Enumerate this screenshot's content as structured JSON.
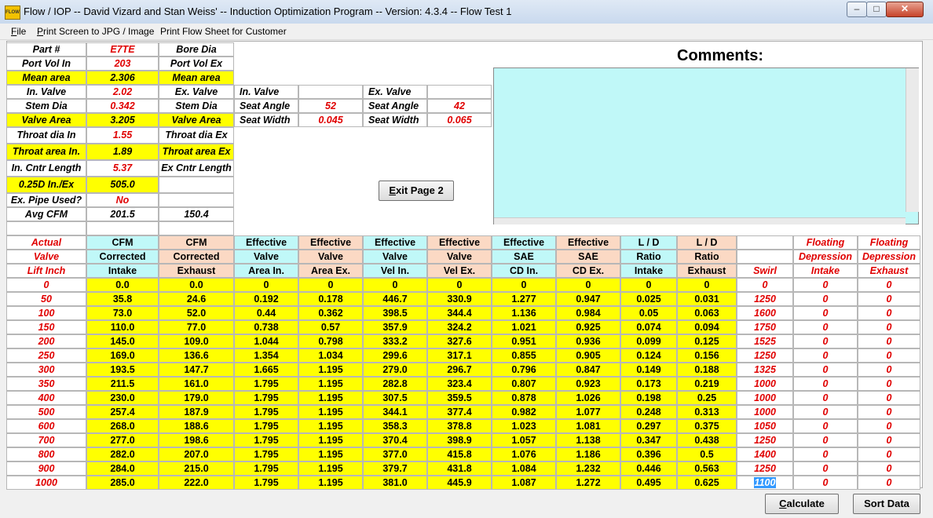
{
  "window": {
    "title": "Flow / IOP -- David Vizard and Stan Weiss' -- Induction Optimization Program -- Version: 4.3.4 -- Flow Test 1",
    "icon_text": "FLOW",
    "controls": {
      "minimize": "–",
      "maximize": "□",
      "close": "✕"
    }
  },
  "menu": [
    "File",
    "Print Screen to JPG / Image",
    "Print Flow Sheet for Customer"
  ],
  "left_table": [
    [
      "Part #",
      "E7TE",
      "Bore Dia"
    ],
    [
      "Port Vol In",
      "203",
      "Port Vol Ex"
    ],
    [
      "Mean area",
      "2.306",
      "Mean area"
    ],
    [
      "In. Valve",
      "2.02",
      "Ex. Valve"
    ],
    [
      "Stem Dia",
      "0.342",
      "Stem Dia"
    ],
    [
      "Valve Area",
      "3.205",
      "Valve Area"
    ],
    [
      "Throat dia In",
      "1.55",
      "Throat dia Ex"
    ],
    [
      "Throat area In.",
      "1.89",
      "Throat area Ex"
    ],
    [
      "In. Cntr Length",
      "5.37",
      "Ex Cntr Length"
    ],
    [
      "0.25D In./Ex",
      "505.0",
      ""
    ],
    [
      "Ex. Pipe Used?",
      "No",
      ""
    ],
    [
      "Avg CFM",
      "201.5",
      "150.4"
    ],
    [
      "",
      "",
      ""
    ]
  ],
  "seat": {
    "in_header": "In. Valve",
    "ex_header": "Ex. Valve",
    "in_angle_label": "Seat Angle",
    "in_angle": "52",
    "ex_angle_label": "Seat Angle",
    "ex_angle": "42",
    "in_width_label": "Seat Width",
    "in_width": "0.045",
    "ex_width_label": "Seat Width",
    "ex_width": "0.065"
  },
  "comments": {
    "title": "Comments:",
    "text": ""
  },
  "buttons": {
    "exit": "Exit Page 2",
    "calculate": "Calculate",
    "sort": "Sort Data"
  },
  "main_headers": [
    [
      "Actual",
      "Valve",
      "Lift Inch"
    ],
    [
      "CFM",
      "Corrected",
      "Intake"
    ],
    [
      "CFM",
      "Corrected",
      "Exhaust"
    ],
    [
      "Effective",
      "Valve",
      "Area In."
    ],
    [
      "Effective",
      "Valve",
      "Area Ex."
    ],
    [
      "Effective",
      "Valve",
      "Vel In."
    ],
    [
      "Effective",
      "Valve",
      "Vel Ex."
    ],
    [
      "Effective",
      "SAE",
      "CD In."
    ],
    [
      "Effective",
      "SAE",
      "CD Ex."
    ],
    [
      "L / D",
      "Ratio",
      "Intake"
    ],
    [
      "L / D",
      "Ratio",
      "Exhaust"
    ],
    [
      "",
      "",
      "Swirl"
    ],
    [
      "Floating",
      "Depression",
      "Intake"
    ],
    [
      "Floating",
      "Depression",
      "Exhaust"
    ]
  ],
  "main_rows": [
    [
      "0",
      "0.0",
      "0.0",
      "0",
      "0",
      "0",
      "0",
      "0",
      "0",
      "0",
      "0",
      "0",
      "0",
      "0"
    ],
    [
      "50",
      "35.8",
      "24.6",
      "0.192",
      "0.178",
      "446.7",
      "330.9",
      "1.277",
      "0.947",
      "0.025",
      "0.031",
      "1250",
      "0",
      "0"
    ],
    [
      "100",
      "73.0",
      "52.0",
      "0.44",
      "0.362",
      "398.5",
      "344.4",
      "1.136",
      "0.984",
      "0.05",
      "0.063",
      "1600",
      "0",
      "0"
    ],
    [
      "150",
      "110.0",
      "77.0",
      "0.738",
      "0.57",
      "357.9",
      "324.2",
      "1.021",
      "0.925",
      "0.074",
      "0.094",
      "1750",
      "0",
      "0"
    ],
    [
      "200",
      "145.0",
      "109.0",
      "1.044",
      "0.798",
      "333.2",
      "327.6",
      "0.951",
      "0.936",
      "0.099",
      "0.125",
      "1525",
      "0",
      "0"
    ],
    [
      "250",
      "169.0",
      "136.6",
      "1.354",
      "1.034",
      "299.6",
      "317.1",
      "0.855",
      "0.905",
      "0.124",
      "0.156",
      "1250",
      "0",
      "0"
    ],
    [
      "300",
      "193.5",
      "147.7",
      "1.665",
      "1.195",
      "279.0",
      "296.7",
      "0.796",
      "0.847",
      "0.149",
      "0.188",
      "1325",
      "0",
      "0"
    ],
    [
      "350",
      "211.5",
      "161.0",
      "1.795",
      "1.195",
      "282.8",
      "323.4",
      "0.807",
      "0.923",
      "0.173",
      "0.219",
      "1000",
      "0",
      "0"
    ],
    [
      "400",
      "230.0",
      "179.0",
      "1.795",
      "1.195",
      "307.5",
      "359.5",
      "0.878",
      "1.026",
      "0.198",
      "0.25",
      "1000",
      "0",
      "0"
    ],
    [
      "500",
      "257.4",
      "187.9",
      "1.795",
      "1.195",
      "344.1",
      "377.4",
      "0.982",
      "1.077",
      "0.248",
      "0.313",
      "1000",
      "0",
      "0"
    ],
    [
      "600",
      "268.0",
      "188.6",
      "1.795",
      "1.195",
      "358.3",
      "378.8",
      "1.023",
      "1.081",
      "0.297",
      "0.375",
      "1050",
      "0",
      "0"
    ],
    [
      "700",
      "277.0",
      "198.6",
      "1.795",
      "1.195",
      "370.4",
      "398.9",
      "1.057",
      "1.138",
      "0.347",
      "0.438",
      "1250",
      "0",
      "0"
    ],
    [
      "800",
      "282.0",
      "207.0",
      "1.795",
      "1.195",
      "377.0",
      "415.8",
      "1.076",
      "1.186",
      "0.396",
      "0.5",
      "1400",
      "0",
      "0"
    ],
    [
      "900",
      "284.0",
      "215.0",
      "1.795",
      "1.195",
      "379.7",
      "431.8",
      "1.084",
      "1.232",
      "0.446",
      "0.563",
      "1250",
      "0",
      "0"
    ],
    [
      "1000",
      "285.0",
      "222.0",
      "1.795",
      "1.195",
      "381.0",
      "445.9",
      "1.087",
      "1.272",
      "0.495",
      "0.625",
      "1100",
      "0",
      "0"
    ]
  ],
  "colors": {
    "yellow": "#ffff00",
    "cyan": "#c0f8f8",
    "peach": "#fbd9c4",
    "red_text": "#e00000"
  }
}
